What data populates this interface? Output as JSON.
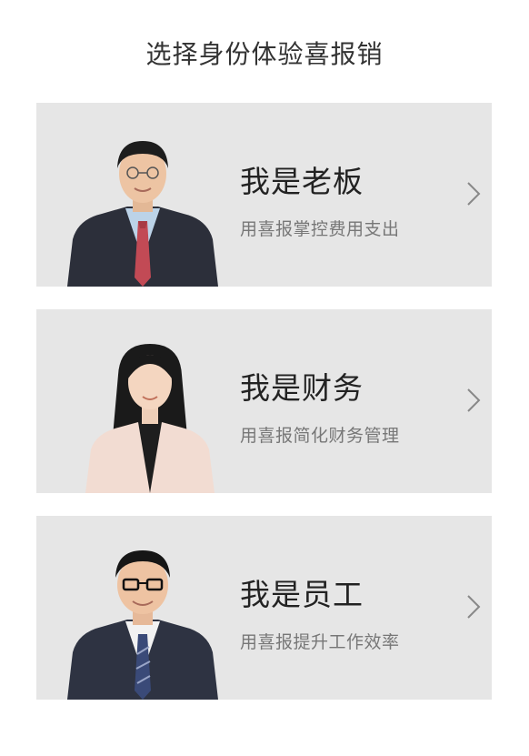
{
  "page": {
    "title": "选择身份体验喜报销"
  },
  "cards": [
    {
      "id": "boss",
      "title": "我是老板",
      "subtitle": "用喜报掌控费用支出"
    },
    {
      "id": "finance",
      "title": "我是财务",
      "subtitle": "用喜报简化财务管理"
    },
    {
      "id": "employee",
      "title": "我是员工",
      "subtitle": "用喜报提升工作效率"
    }
  ],
  "colors": {
    "card_bg": "#e6e6e6",
    "title": "#222222",
    "subtitle": "#777777",
    "chevron": "#888888"
  },
  "icons": {
    "card_arrow": "chevron-right-icon"
  }
}
